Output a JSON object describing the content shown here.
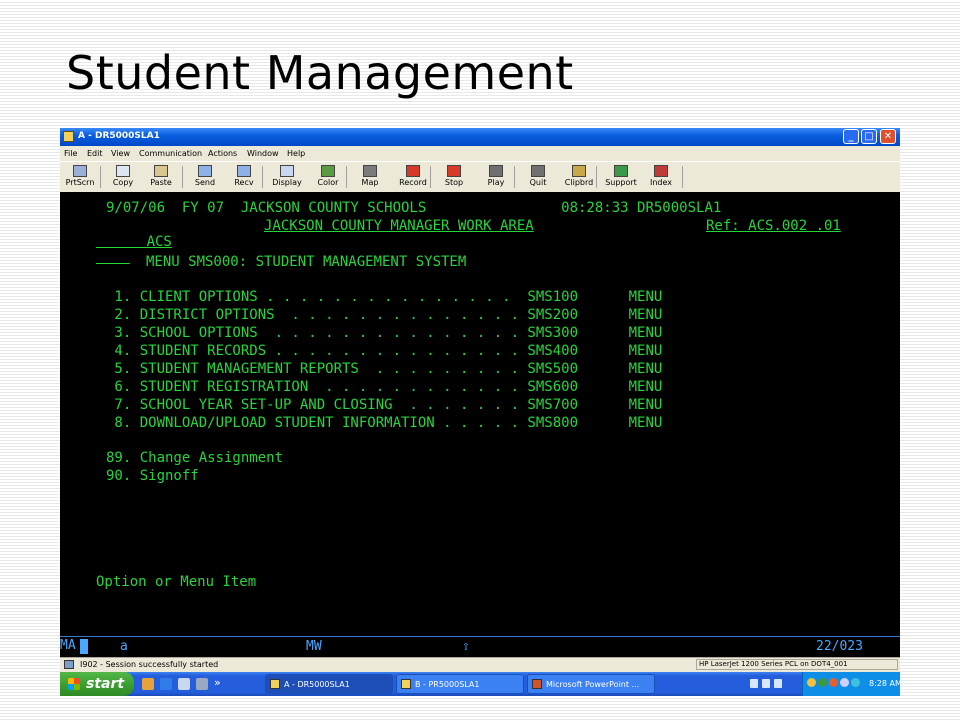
{
  "slide": {
    "title": "Student Management"
  },
  "window": {
    "title": "A - DR5000SLA1",
    "min_glyph": "_",
    "max_glyph": "□",
    "close_glyph": "✕"
  },
  "menu": [
    "File",
    "Edit",
    "View",
    "Communication",
    "Actions",
    "Window",
    "Help"
  ],
  "toolbar": [
    {
      "name": "prtscrn",
      "label": "PrtScrn",
      "icon": "printer-icon",
      "color": "#9bb0d8"
    },
    {
      "name": "copy",
      "label": "Copy",
      "icon": "copy-icon",
      "color": "#dfe6f3"
    },
    {
      "name": "paste",
      "label": "Paste",
      "icon": "paste-icon",
      "color": "#d8c890"
    },
    {
      "name": "send",
      "label": "Send",
      "icon": "send-icon",
      "color": "#8fb2e8"
    },
    {
      "name": "recv",
      "label": "Recv",
      "icon": "receive-icon",
      "color": "#8fb2e8"
    },
    {
      "name": "display",
      "label": "Display",
      "icon": "display-icon",
      "color": "#c8d6f0"
    },
    {
      "name": "color",
      "label": "Color",
      "icon": "color-icon",
      "color": "#5b9a45"
    },
    {
      "name": "map",
      "label": "Map",
      "icon": "map-icon",
      "color": "#7b7b7b"
    },
    {
      "name": "record",
      "label": "Record",
      "icon": "record-icon",
      "color": "#d83a2a"
    },
    {
      "name": "stop",
      "label": "Stop",
      "icon": "stop-icon",
      "color": "#d83a2a"
    },
    {
      "name": "play",
      "label": "Play",
      "icon": "play-icon",
      "color": "#6f6f6f"
    },
    {
      "name": "quit",
      "label": "Quit",
      "icon": "quit-icon",
      "color": "#6f6f6f"
    },
    {
      "name": "clipbrd",
      "label": "Clipbrd",
      "icon": "clipboard-icon",
      "color": "#c7a94a"
    },
    {
      "name": "support",
      "label": "Support",
      "icon": "support-icon",
      "color": "#3a9a4a"
    },
    {
      "name": "index",
      "label": "Index",
      "icon": "index-icon",
      "color": "#c03a3a"
    }
  ],
  "terminal": {
    "header1": "9/07/06  FY 07  JACKSON COUNTY SCHOOLS                08:28:33 DR5000SLA1",
    "header2_left": "ACS",
    "header2_mid": "JACKSON COUNTY MANAGER WORK AREA",
    "header2_right": "Ref: ACS.002 .01",
    "menu_title": "MENU SMS000: STUDENT MANAGEMENT SYSTEM",
    "items": [
      " 1. CLIENT OPTIONS . . . . . . . . . . . . . . .  SMS100      MENU",
      " 2. DISTRICT OPTIONS  . . . . . . . . . . . . . . SMS200      MENU",
      " 3. SCHOOL OPTIONS  . . . . . . . . . . . . . . . SMS300      MENU",
      " 4. STUDENT RECORDS . . . . . . . . . . . . . . . SMS400      MENU",
      " 5. STUDENT MANAGEMENT REPORTS  . . . . . . . . . SMS500      MENU",
      " 6. STUDENT REGISTRATION  . . . . . . . . . . . . SMS600      MENU",
      " 7. SCHOOL YEAR SET-UP AND CLOSING  . . . . . . . SMS700      MENU",
      " 8. DOWNLOAD/UPLOAD STUDENT INFORMATION . . . . . SMS800      MENU"
    ],
    "extra_items": [
      "89. Change Assignment",
      "90. Signoff"
    ],
    "prompt": "Option or Menu Item"
  },
  "oia": {
    "ma": "MA",
    "a": "a",
    "mw": "MW",
    "arrow": "⇧",
    "position": "22/023"
  },
  "statusbar": {
    "message": "I902 - Session successfully started",
    "printer": "HP LaserJet 1200 Series PCL on DOT4_001"
  },
  "taskbar": {
    "start": "start",
    "chevron": "»",
    "tasks": [
      {
        "label": "A - DR5000SLA1",
        "active": true
      },
      {
        "label": "B - PR5000SLA1",
        "active": false
      },
      {
        "label": "Microsoft PowerPoint ...",
        "active": false
      }
    ],
    "clock": "8:28 AM"
  }
}
